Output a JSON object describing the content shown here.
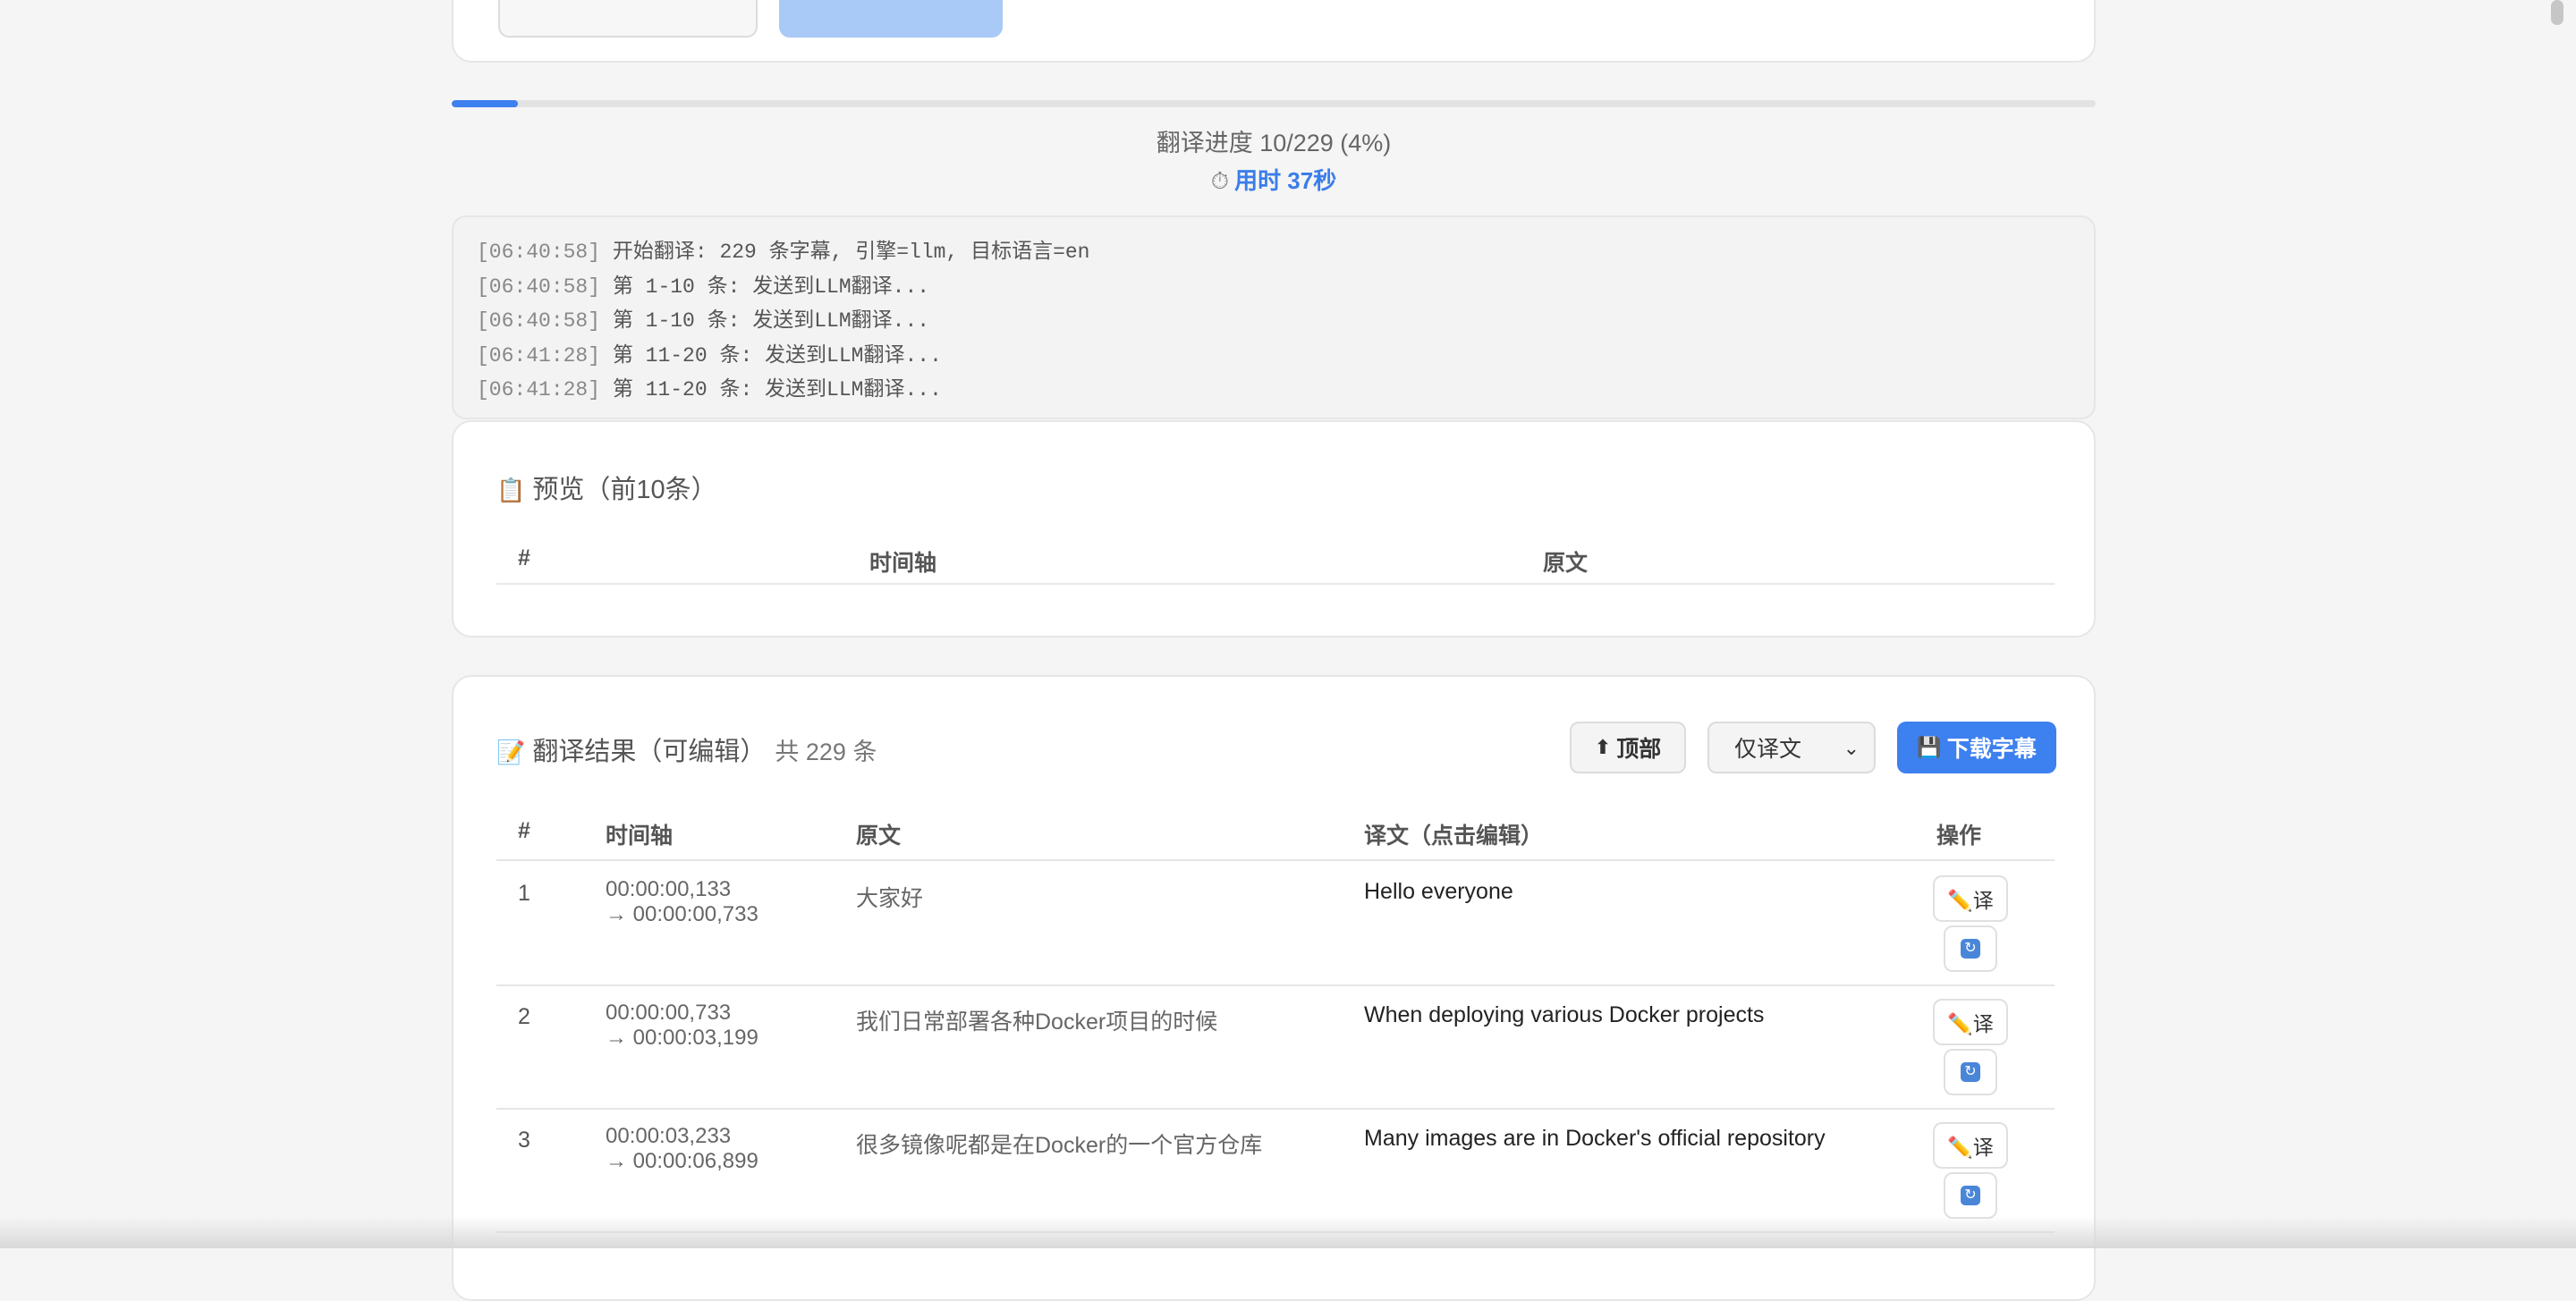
{
  "progress": {
    "fraction": 0.04,
    "text": "翻译进度 10/229 (4%)",
    "elapsed_icon": "stopwatch-icon",
    "elapsed_text": "用时 37秒"
  },
  "log": [
    {
      "ts": "[06:40:58]",
      "msg": " 开始翻译: 229 条字幕, 引擎=llm, 目标语言=en"
    },
    {
      "ts": "[06:40:58]",
      "msg": " 第 1-10 条: 发送到LLM翻译..."
    },
    {
      "ts": "[06:40:58]",
      "msg": " 第 1-10 条: 发送到LLM翻译..."
    },
    {
      "ts": "[06:41:28]",
      "msg": " 第 11-20 条: 发送到LLM翻译..."
    },
    {
      "ts": "[06:41:28]",
      "msg": " 第 11-20 条: 发送到LLM翻译..."
    }
  ],
  "preview": {
    "icon": "clipboard-icon",
    "title": "预览（前10条）",
    "columns": [
      "#",
      "时间轴",
      "原文"
    ]
  },
  "results": {
    "icon": "memo-icon",
    "title": "翻译结果（可编辑）",
    "count": "共 229 条",
    "top_button": "顶部",
    "top_icon": "up-arrow-icon",
    "mode_select": "仅译文",
    "download_button": "下载字幕",
    "download_icon": "floppy-disk-icon",
    "columns": [
      "#",
      "时间轴",
      "原文",
      "译文（点击编辑）",
      "操作"
    ],
    "edit_label": "✏️译",
    "rows": [
      {
        "num": "1",
        "start": "00:00:00,133",
        "end": "→ 00:00:00,733",
        "orig": "大家好",
        "trans": "Hello everyone"
      },
      {
        "num": "2",
        "start": "00:00:00,733",
        "end": "→ 00:00:03,199",
        "orig": "我们日常部署各种Docker项目的时候",
        "trans": "When deploying various Docker projects"
      },
      {
        "num": "3",
        "start": "00:00:03,233",
        "end": "→ 00:00:06,899",
        "orig": "很多镜像呢都是在Docker的一个官方仓库",
        "trans": "Many images are in Docker's official repository"
      }
    ]
  },
  "colors": {
    "accent": "#3d80ef",
    "background": "#f5f5f5"
  }
}
